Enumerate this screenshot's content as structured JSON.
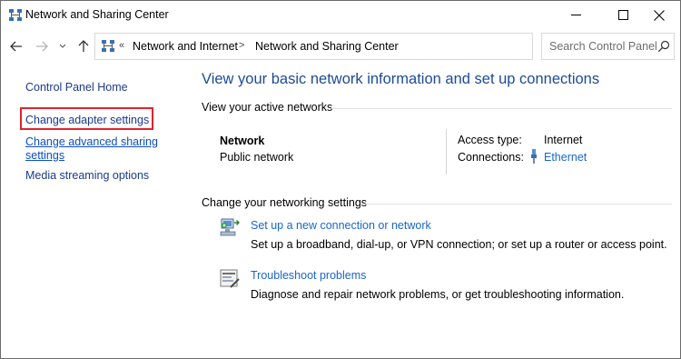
{
  "window": {
    "title": "Network and Sharing Center",
    "icon": "network-icon"
  },
  "address": {
    "overflow": "«",
    "crumbs": [
      "Network and Internet",
      "Network and Sharing Center"
    ],
    "separator": ">"
  },
  "search": {
    "placeholder": "Search Control Panel"
  },
  "sidebar": {
    "items": [
      {
        "label": "Control Panel Home"
      },
      {
        "label": "Change adapter settings"
      },
      {
        "label_line1": "Change advanced sharing",
        "label_line2": "settings"
      },
      {
        "label": "Media streaming options"
      }
    ]
  },
  "main": {
    "title": "View your basic network information and set up connections",
    "active_networks_label": "View your active networks",
    "network": {
      "name": "Network",
      "type": "Public network",
      "access_type_label": "Access type:",
      "access_type_value": "Internet",
      "connections_label": "Connections:",
      "connections_value": "Ethernet"
    },
    "change_settings_label": "Change your networking settings",
    "tasks": [
      {
        "link": "Set up a new connection or network",
        "desc": "Set up a broadband, dial-up, or VPN connection; or set up a router or access point.",
        "icon": "new-connection-icon"
      },
      {
        "link": "Troubleshoot problems",
        "desc": "Diagnose and repair network problems, or get troubleshooting information.",
        "icon": "troubleshoot-icon"
      }
    ]
  },
  "colors": {
    "link": "#1a66c8",
    "heading": "#1c4b97",
    "highlight": "#e0232c"
  }
}
